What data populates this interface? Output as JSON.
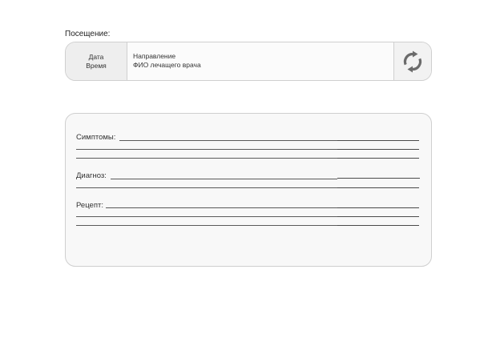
{
  "visit": {
    "title": "Посещение:",
    "date_label": "Дата",
    "time_label": "Время",
    "direction_label": "Направление",
    "doctor_label": "ФИО лечащего врача",
    "refresh_icon": "refresh-icon"
  },
  "record": {
    "symptoms_label": "Симптомы:",
    "diagnosis_label": "Диагноз:",
    "prescription_label": "Рецепт:"
  }
}
